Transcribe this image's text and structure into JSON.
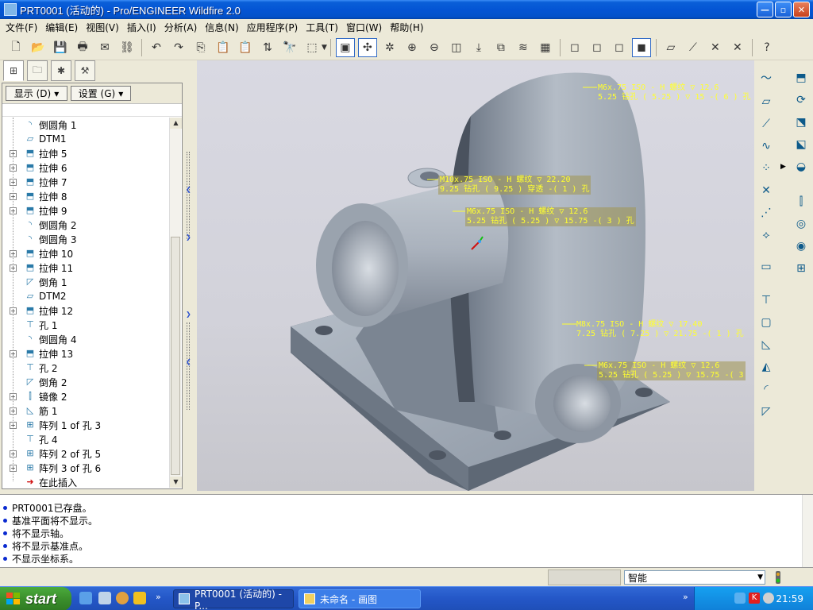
{
  "window": {
    "title": "PRT0001 (活动的) - Pro/ENGINEER Wildfire 2.0",
    "controls": {
      "minimize": "—",
      "maximize": "▫",
      "close": "✕"
    }
  },
  "menu": [
    "文件(F)",
    "编辑(E)",
    "视图(V)",
    "插入(I)",
    "分析(A)",
    "信息(N)",
    "应用程序(P)",
    "工具(T)",
    "窗口(W)",
    "帮助(H)"
  ],
  "nav_panel": {
    "display_button": "显示 (D)",
    "settings_button": "设置 (G)",
    "tree": [
      {
        "label": "倒圆角 1",
        "icon": "round-icon",
        "expandable": false
      },
      {
        "label": "DTM1",
        "icon": "datum-plane-icon",
        "expandable": false
      },
      {
        "label": "拉伸 5",
        "icon": "extrude-icon",
        "expandable": true
      },
      {
        "label": "拉伸 6",
        "icon": "extrude-icon",
        "expandable": true
      },
      {
        "label": "拉伸 7",
        "icon": "extrude-icon",
        "expandable": true
      },
      {
        "label": "拉伸 8",
        "icon": "extrude-icon",
        "expandable": true
      },
      {
        "label": "拉伸 9",
        "icon": "extrude-icon",
        "expandable": true
      },
      {
        "label": "倒圆角 2",
        "icon": "round-icon",
        "expandable": false
      },
      {
        "label": "倒圆角 3",
        "icon": "round-icon",
        "expandable": false
      },
      {
        "label": "拉伸 10",
        "icon": "extrude-icon",
        "expandable": true
      },
      {
        "label": "拉伸 11",
        "icon": "extrude-icon",
        "expandable": true
      },
      {
        "label": "倒角 1",
        "icon": "chamfer-icon",
        "expandable": false
      },
      {
        "label": "DTM2",
        "icon": "datum-plane-icon",
        "expandable": false
      },
      {
        "label": "拉伸 12",
        "icon": "extrude-icon",
        "expandable": true
      },
      {
        "label": "孔 1",
        "icon": "hole-icon",
        "expandable": false
      },
      {
        "label": "倒圆角 4",
        "icon": "round-icon",
        "expandable": false
      },
      {
        "label": "拉伸 13",
        "icon": "extrude-icon",
        "expandable": true
      },
      {
        "label": "孔 2",
        "icon": "hole-icon",
        "expandable": false
      },
      {
        "label": "倒角 2",
        "icon": "chamfer-icon",
        "expandable": false
      },
      {
        "label": "镜像 2",
        "icon": "mirror-icon",
        "expandable": true
      },
      {
        "label": "筋 1",
        "icon": "rib-icon",
        "expandable": true
      },
      {
        "label": "阵列 1 of 孔 3",
        "icon": "pattern-icon",
        "expandable": true
      },
      {
        "label": "孔 4",
        "icon": "hole-icon",
        "expandable": false
      },
      {
        "label": "阵列 2 of 孔 5",
        "icon": "pattern-icon",
        "expandable": true
      },
      {
        "label": "阵列 3 of 孔 6",
        "icon": "pattern-icon",
        "expandable": true
      },
      {
        "label": "在此插入",
        "icon": "insert-here-icon",
        "expandable": false
      }
    ]
  },
  "annotations": [
    {
      "line1": "M6x.75 ISO - H 螺纹 ▽ 12.6",
      "line2": "5.25 钻孔 ( 5.25 ) ▽ 15  -( 6 ) 孔"
    },
    {
      "line1": "M10x.75 ISO - H 螺纹 ▽ 22.20",
      "line2": "9.25 钻孔 ( 9.25 )  穿透  -( 1 ) 孔"
    },
    {
      "line1": "M6x.75 ISO - H 螺纹 ▽ 12.6",
      "line2": "5.25 钻孔 ( 5.25 ) ▽ 15.75  -( 3 ) 孔"
    },
    {
      "line1": "M8x.75 ISO - H 螺纹 ▽ 17.40",
      "line2": "7.25 钻孔 ( 7.25 ) ▽ 21.75  -( 1 ) 孔"
    },
    {
      "line1": "M6x.75 ISO - H 螺纹 ▽ 12.6",
      "line2": "5.25 钻孔 ( 5.25 ) ▽ 15.75  -( 3"
    }
  ],
  "messages": [
    "PRT0001已存盘。",
    "基准平面将不显示。",
    "将不显示轴。",
    "将不显示基准点。",
    "不显示坐标系。"
  ],
  "status": {
    "filter": "智能"
  },
  "taskbar": {
    "start": "start",
    "tasks": [
      "PRT0001 (活动的) - P...",
      "未命名 - 画图"
    ],
    "clock": "21:59"
  },
  "colors": {
    "model": "#a9b2bd",
    "annotation": "#ffff30",
    "titlebar": "#0455d4"
  }
}
